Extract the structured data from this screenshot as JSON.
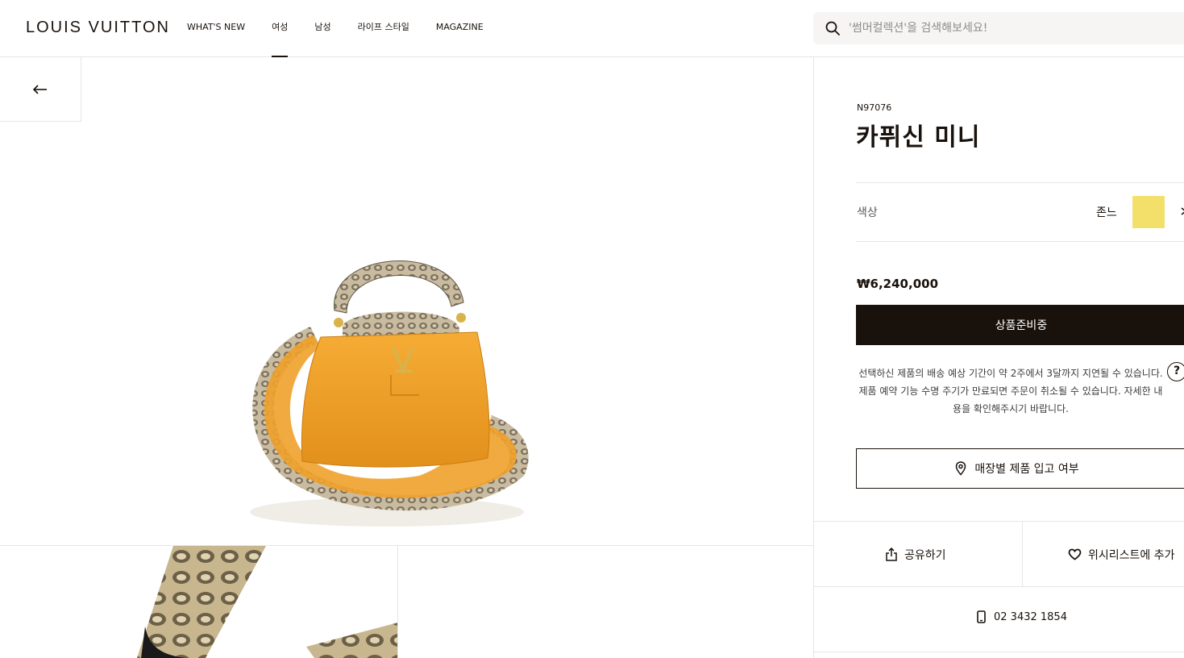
{
  "header": {
    "logo": "LOUIS VUITTON",
    "nav": [
      "WHAT'S NEW",
      "여성",
      "남성",
      "라이프 스타일",
      "MAGAZINE"
    ],
    "active_nav_index": 1,
    "search_placeholder": "'썸머컬렉션'을 검색해보세요!"
  },
  "product": {
    "sku": "N97076",
    "name": "카퓌신 미니",
    "color_label": "색상",
    "color_name": "존느",
    "swatch_color": "#f2e06a",
    "price": "₩6,240,000",
    "cta_label": "상품준비중",
    "notice": "선택하신 제품의 배송 예상 기간이 약 2주에서 3달까지 지연될 수 있습니다. 제품 예약 기능 수명 주기가 만료되면 주문이 취소될 수 있습니다. 자세한 내용을 확인해주시기 바랍니다.",
    "help_icon_label": "?",
    "store_availability_label": "매장별 제품 입고 여부",
    "share_label": "공유하기",
    "wishlist_label": "위시리스트에 추가",
    "phone": "02 3432 1854"
  },
  "colors": {
    "brand_dark": "#19110b",
    "bag_orange": "#f0a12a"
  },
  "icons": {
    "search": "search-icon",
    "back": "arrow-left-icon",
    "pin": "location-pin-icon",
    "share": "share-icon",
    "heart": "heart-icon",
    "phone": "phone-icon",
    "chevron": "chevron-right-icon"
  }
}
